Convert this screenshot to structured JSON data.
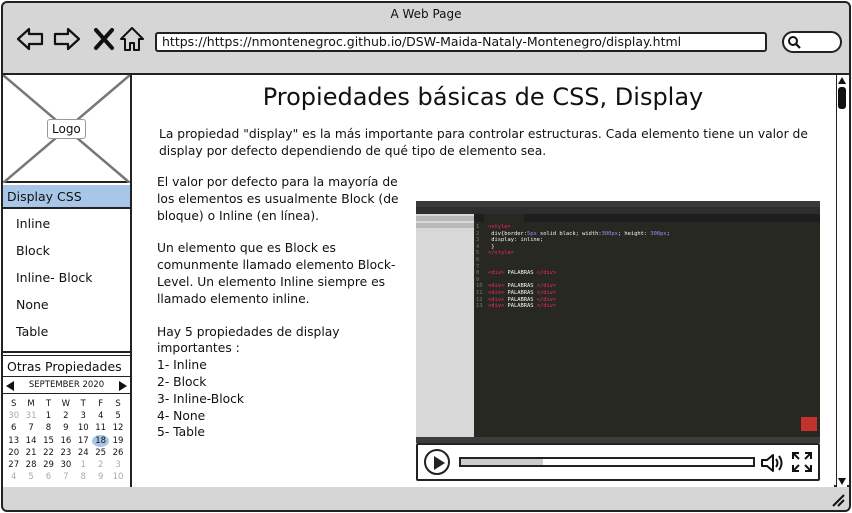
{
  "window": {
    "title": "A Web Page",
    "url": "https://https://nmontenegroc.github.io/DSW-Maida-Nataly-Montenegro/display.html"
  },
  "sidebar": {
    "logo_label": "Logo",
    "selected_item": "Display CSS",
    "items": [
      {
        "label": "Inline"
      },
      {
        "label": "Block"
      },
      {
        "label": "Inline- Block"
      },
      {
        "label": "None"
      },
      {
        "label": "Table"
      }
    ],
    "other_label": "Otras Propiedades"
  },
  "calendar": {
    "month_label": "SEPTEMBER 2020",
    "weekdays": [
      "S",
      "M",
      "T",
      "W",
      "T",
      "F",
      "S"
    ],
    "selected_day": "18",
    "weeks": [
      [
        "30",
        "31",
        "1",
        "2",
        "3",
        "4",
        "5"
      ],
      [
        "6",
        "7",
        "8",
        "9",
        "10",
        "11",
        "12"
      ],
      [
        "13",
        "14",
        "15",
        "16",
        "17",
        "18",
        "19"
      ],
      [
        "20",
        "21",
        "22",
        "23",
        "24",
        "25",
        "26"
      ],
      [
        "27",
        "28",
        "29",
        "30",
        "1",
        "2",
        "3"
      ],
      [
        "4",
        "5",
        "6",
        "7",
        "8",
        "9",
        "10"
      ]
    ]
  },
  "main": {
    "heading": "Propiedades básicas de CSS, Display",
    "intro": "La propiedad \"display\"  es la más importante para controlar estructuras. Cada elemento tiene un valor de display por defecto dependiendo de qué tipo de elemento sea.",
    "para1": "El valor por defecto para la mayoría de los elementos es usualmente Block (de bloque) o Inline (en línea).",
    "para2": "Un elemento que es Block es comunmente llamado elemento Block-Level. Un elemento Inline siempre es llamado elemento inline.",
    "list_intro": "Hay 5 propiedades de display importantes :",
    "list": [
      "1-  Inline",
      "2- Block",
      "3- Inline-Block",
      "4- None",
      "5- Table"
    ]
  },
  "video": {
    "progress": 0.28,
    "code_lines": [
      "<style>",
      "  div{border:5px solid black; width:300px; height: 300px;",
      "  display: inline;",
      "  }",
      "</style>",
      "",
      "",
      "<div> PALABRAS </div>",
      "",
      "<div> PALABRAS </div>",
      "<div> PALABRAS </div>",
      "<div> PALABRAS </div>",
      "<div> PALABRAS </div>"
    ]
  },
  "colors": {
    "selection": "#a7c6e8",
    "editor_bg": "#272822",
    "border": "#222222"
  }
}
